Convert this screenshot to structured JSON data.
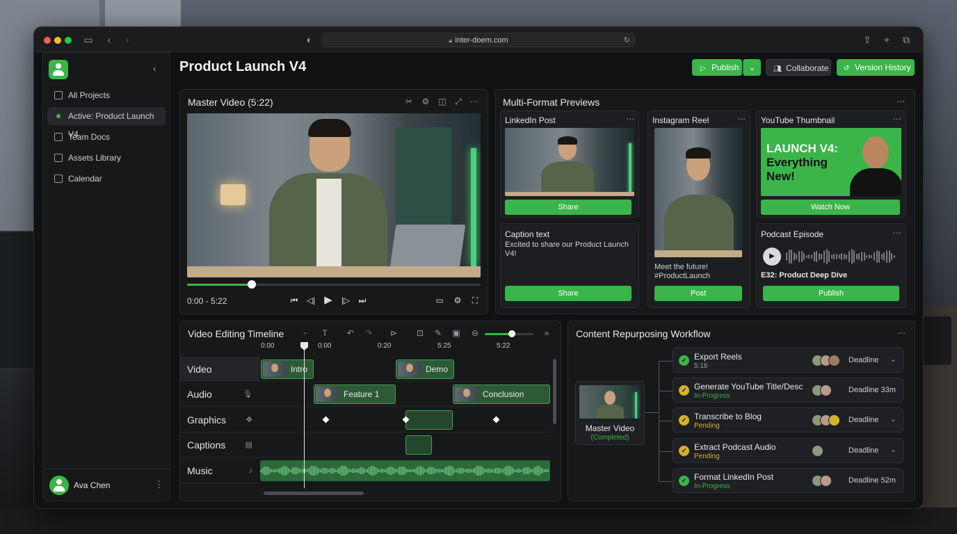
{
  "browser": {
    "url": "inter-doem.com"
  },
  "sidebar": {
    "items": [
      {
        "label": "All Projects"
      },
      {
        "label": "Active: Product Launch V4"
      },
      {
        "label": "Team Docs"
      },
      {
        "label": "Assets Library"
      },
      {
        "label": "Calendar"
      }
    ],
    "user": {
      "name": "Ava Chen"
    }
  },
  "header": {
    "title": "Product Launch V4",
    "publish_label": "Publish",
    "collaborate_label": "Collaborate",
    "version_history_label": "Version History"
  },
  "master_video": {
    "title": "Master Video (5:22)",
    "time": "0:00 - 5:22",
    "progress": 0.22
  },
  "previews": {
    "title": "Multi-Format Previews",
    "linkedin": {
      "title": "LinkedIn Post",
      "button": "Share"
    },
    "caption": {
      "title": "Caption text",
      "text": "Excited to share our Product Launch V4!",
      "button": "Share"
    },
    "instagram": {
      "title": "Instagram Reel",
      "caption_line1": "Meet the future!",
      "caption_line2": "#ProductLaunch",
      "button": "Post"
    },
    "youtube": {
      "title": "YouTube Thumbnail",
      "headline_1": "LAUNCH V4:",
      "headline_2": "Everything",
      "headline_3": "New!",
      "button": "Watch Now"
    },
    "podcast": {
      "title": "Podcast Episode",
      "episode": "E32: Product Deep Dive",
      "button": "Publish"
    }
  },
  "timeline": {
    "title": "Video Editing Timeline",
    "ruler": [
      "0:00",
      "0:00",
      "0:20",
      "5:25",
      "5:22"
    ],
    "zoom_level": 0.55,
    "tracks": [
      {
        "label": "Video"
      },
      {
        "label": "Audio"
      },
      {
        "label": "Graphics"
      },
      {
        "label": "Captions"
      },
      {
        "label": "Music"
      }
    ],
    "clips": {
      "intro": "Intro",
      "demo": "Demo",
      "feature_1": "Feature 1",
      "conclusion": "Conclusion"
    }
  },
  "workflow": {
    "title": "Content Repurposing Workflow",
    "source": {
      "label": "Master Video",
      "status": "(Completed)"
    },
    "tasks": [
      {
        "name": "Export Reels",
        "status": "5:18",
        "deadline": "Deadline"
      },
      {
        "name": "Generate YouTube Title/Desc",
        "status": "In-Progress",
        "deadline": "Deadline 33m"
      },
      {
        "name": "Transcribe to Blog",
        "status": "Pending",
        "deadline": "Deadline"
      },
      {
        "name": "Extract Podcast Audio",
        "status": "Pending",
        "deadline": "Deadline"
      },
      {
        "name": "Format LinkedIn Post",
        "status": "In-Progress",
        "deadline": "Deadline 52m"
      }
    ]
  },
  "colors": {
    "accent": "#3bb54a",
    "pending": "#d4b22a",
    "in_progress": "#d4b22a",
    "done": "#3bb54a"
  }
}
